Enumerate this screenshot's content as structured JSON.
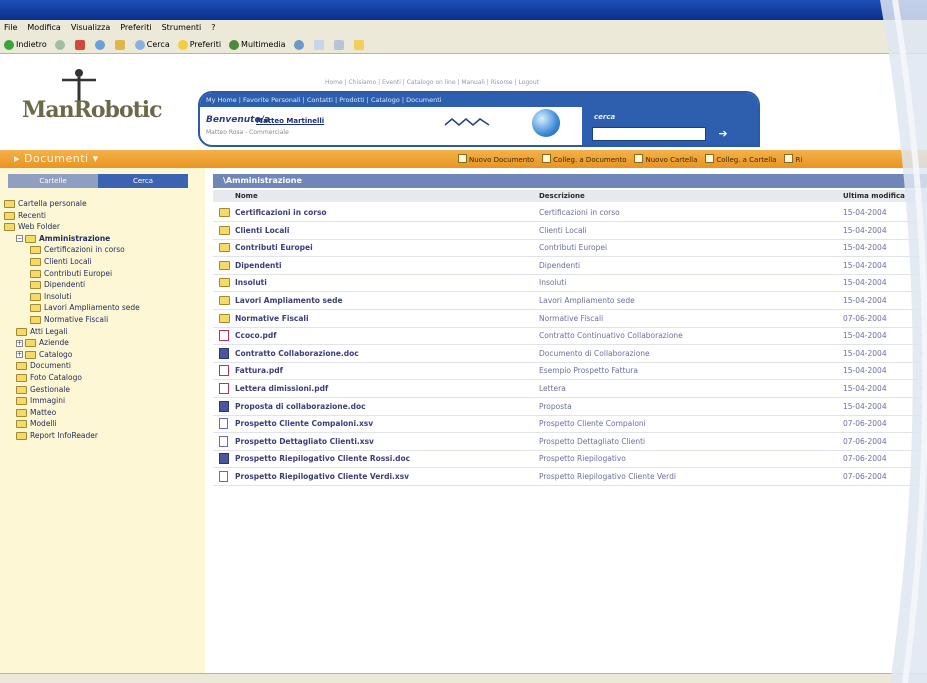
{
  "menu": [
    "File",
    "Modifica",
    "Visualizza",
    "Preferiti",
    "Strumenti",
    "?"
  ],
  "toolbar": {
    "back": "Indietro",
    "search": "Cerca",
    "favorites": "Preferiti",
    "multimedia": "Multimedia"
  },
  "logo": {
    "text": "ManRobotic"
  },
  "top_links": "Home | Chisiamo | Eventi | Catalogo on line | Manuali | Risorse | Logout",
  "nav_links": "My Home | Favorite Personali | Contatti | Prodotti | Catalogo | Documenti",
  "welcome": {
    "greeting": "Benvenuto/a",
    "user": "Matteo Martinelli",
    "role": "Matteo Rosa - Commerciale"
  },
  "search": {
    "label": "cerca",
    "value": ""
  },
  "section_title": "Documenti",
  "actions": [
    "Nuovo Documento",
    "Colleg. a Documento",
    "Nuovo Cartella",
    "Colleg. a Cartella",
    "Ri"
  ],
  "sidebar": {
    "tabs": [
      "Cartelle",
      "Cerca"
    ],
    "tree": [
      {
        "label": "Cartella personale",
        "level": 0
      },
      {
        "label": "Recenti",
        "level": 0
      },
      {
        "label": "Web Folder",
        "level": 0
      },
      {
        "label": "Amministrazione",
        "level": 1
      },
      {
        "label": "Certificazioni in corso",
        "level": 2
      },
      {
        "label": "Clienti Locali",
        "level": 2
      },
      {
        "label": "Contributi Europei",
        "level": 2
      },
      {
        "label": "Dipendenti",
        "level": 2
      },
      {
        "label": "Insoluti",
        "level": 2
      },
      {
        "label": "Lavori Ampliamento sede",
        "level": 2
      },
      {
        "label": "Normative Fiscali",
        "level": 2
      },
      {
        "label": "Atti Legali",
        "level": 1
      },
      {
        "label": "Aziende",
        "level": 1
      },
      {
        "label": "Catalogo",
        "level": 1
      },
      {
        "label": "Documenti",
        "level": 1
      },
      {
        "label": "Foto Catalogo",
        "level": 1
      },
      {
        "label": "Gestionale",
        "level": 1
      },
      {
        "label": "Immagini",
        "level": 1
      },
      {
        "label": "Matteo",
        "level": 1
      },
      {
        "label": "Modelli",
        "level": 1
      },
      {
        "label": "Report InfoReader",
        "level": 1
      }
    ]
  },
  "main": {
    "title": "\\Amministrazione",
    "columns": {
      "name": "Nome",
      "desc": "Descrizione",
      "date": "Ultima modifica"
    },
    "rows": [
      {
        "icon": "folder",
        "name": "Certificazioni in corso",
        "desc": "Certificazioni in corso",
        "date": "15-04-2004"
      },
      {
        "icon": "folder",
        "name": "Clienti Locali",
        "desc": "Clienti Locali",
        "date": "15-04-2004"
      },
      {
        "icon": "folder",
        "name": "Contributi Europei",
        "desc": "Contributi Europei",
        "date": "15-04-2004"
      },
      {
        "icon": "folder",
        "name": "Dipendenti",
        "desc": "Dipendenti",
        "date": "15-04-2004"
      },
      {
        "icon": "folder",
        "name": "Insoluti",
        "desc": "Insoluti",
        "date": "15-04-2004"
      },
      {
        "icon": "folder",
        "name": "Lavori Ampliamento sede",
        "desc": "Lavori Ampliamento sede",
        "date": "15-04-2004"
      },
      {
        "icon": "folder",
        "name": "Normative Fiscali",
        "desc": "Normative Fiscali",
        "date": "07-06-2004"
      },
      {
        "icon": "pdf",
        "name": "Ccoco.pdf",
        "desc": "Contratto Continuativo Collaborazione",
        "date": "15-04-2004"
      },
      {
        "icon": "doc",
        "name": "Contratto Collaborazione.doc",
        "desc": "Documento di Collaborazione",
        "date": "15-04-2004"
      },
      {
        "icon": "pdf",
        "name": "Fattura.pdf",
        "desc": "Esempio Prospetto Fattura",
        "date": "15-04-2004"
      },
      {
        "icon": "pdf",
        "name": "Lettera dimissioni.pdf",
        "desc": "Lettera",
        "date": "15-04-2004"
      },
      {
        "icon": "doc",
        "name": "Proposta di collaborazione.doc",
        "desc": "Proposta",
        "date": "15-04-2004"
      },
      {
        "icon": "xls",
        "name": "Prospetto Cliente Compaloni.xsv",
        "desc": "Prospetto Cliente Compaloni",
        "date": "07-06-2004"
      },
      {
        "icon": "xls",
        "name": "Prospetto Dettagliato Clienti.xsv",
        "desc": "Prospetto Dettagliato Clienti",
        "date": "07-06-2004"
      },
      {
        "icon": "doc",
        "name": "Prospetto Riepilogativo Cliente Rossi.doc",
        "desc": "Prospetto Riepilogativo",
        "date": "07-06-2004"
      },
      {
        "icon": "xls",
        "name": "Prospetto Riepilogativo Cliente Verdi.xsv",
        "desc": "Prospetto Riepilogativo Cliente Verdi",
        "date": "07-06-2004"
      }
    ]
  },
  "colors": {
    "accent_orange": "#e89421",
    "nav_blue": "#2e5fae",
    "sidebar_bg": "#fdf7d6"
  }
}
